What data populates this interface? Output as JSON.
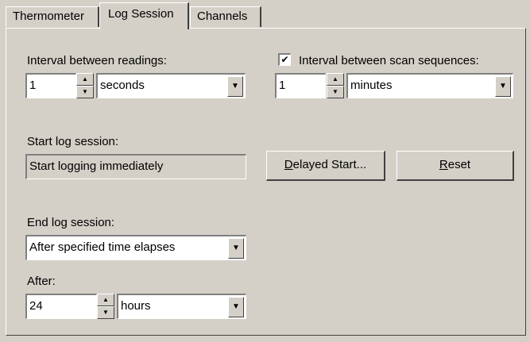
{
  "tabs": [
    {
      "label": "Thermometer",
      "active": false
    },
    {
      "label": "Log Session",
      "active": true
    },
    {
      "label": "Channels",
      "active": false
    }
  ],
  "interval_readings": {
    "label": "Interval between readings:",
    "value": "1",
    "unit": "seconds"
  },
  "interval_scan": {
    "checked": true,
    "check_mark": "✔",
    "label": "Interval between scan sequences:",
    "value": "1",
    "unit": "minutes"
  },
  "start_session": {
    "label": "Start log session:",
    "value": "Start logging immediately"
  },
  "buttons": {
    "delayed_start_mnemonic": "D",
    "delayed_start_rest": "elayed Start...",
    "reset_mnemonic": "R",
    "reset_rest": "eset"
  },
  "end_session": {
    "label": "End log session:",
    "value": "After specified time elapses"
  },
  "after": {
    "label": "After:",
    "value": "24",
    "unit": "hours"
  },
  "icons": {
    "spin_up": "▲",
    "spin_down": "▼",
    "dropdown": "▼"
  }
}
